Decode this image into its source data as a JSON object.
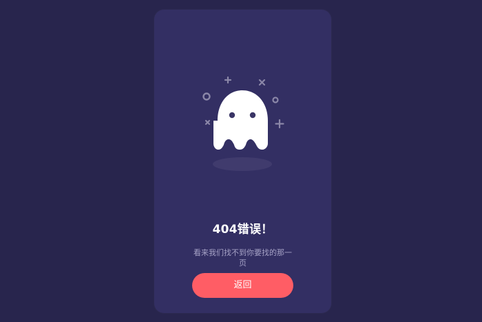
{
  "error_card": {
    "title": "404错误！",
    "message": "看来我们找不到你要找的那一页",
    "back_label": "返回"
  },
  "colors": {
    "page_background": "#28254d",
    "card_background": "#332f63",
    "ghost": "#ffffff",
    "decoration": "#8b87a8",
    "subtitle": "#a6a2c6",
    "button": "#ff5d65"
  },
  "icons": {
    "illustration": "ghost-icon",
    "decorations": [
      "plus-icon",
      "close-icon",
      "circle-icon",
      "close-icon",
      "circle-icon",
      "plus-icon"
    ]
  }
}
